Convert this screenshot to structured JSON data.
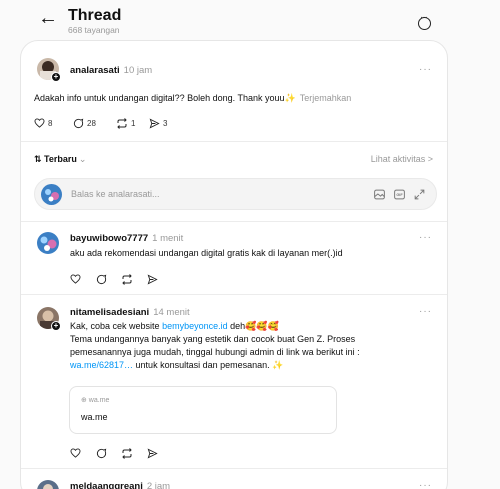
{
  "header": {
    "back_icon": "arrow-left-icon",
    "title": "Thread",
    "subtitle": "668 tayangan",
    "more_icon": "more-circle-icon"
  },
  "post": {
    "username": "analarasati",
    "time": "10 jam",
    "text": "Adakah info untuk undangan digital?? Boleh dong. Thank youu",
    "emoji": "✨",
    "translate": "Terjemahkan",
    "likes": "8",
    "comments": "28",
    "reposts": "1",
    "shares": "3"
  },
  "sort": {
    "label": "Terbaru",
    "chevron": "⌄",
    "activity": "Lihat aktivitas >"
  },
  "reply": {
    "placeholder": "Balas ke analarasati..."
  },
  "replies": [
    {
      "username": "bayuwibowo7777",
      "time": "1 menit",
      "text": "aku ada rekomendasi undangan digital gratis kak di layanan mer(.)id"
    },
    {
      "username": "nitamelisadesiani",
      "time": "14 menit",
      "line1_prefix": "Kak, coba cek website ",
      "line1_link": "bemybeyonce.id",
      "line1_suffix": " deh🥰🥰🥰",
      "line2": "Tema undangannya banyak yang estetik dan cocok buat Gen Z. Proses",
      "line3": "pemesanannya juga mudah, tinggal hubungi admin di link wa berikut ini :",
      "line4_link": "wa.me/62817…",
      "line4_suffix": " untuk konsultasi dan pemesanan. ✨",
      "preview_host": "⊕ wa.me",
      "preview_title": "wa.me"
    },
    {
      "username": "meldaanggreani",
      "time": "2 jam"
    }
  ],
  "more_dots": "···",
  "colors": {
    "link": "#0095f6",
    "muted": "#999999",
    "card_border": "#e6e6e6"
  }
}
